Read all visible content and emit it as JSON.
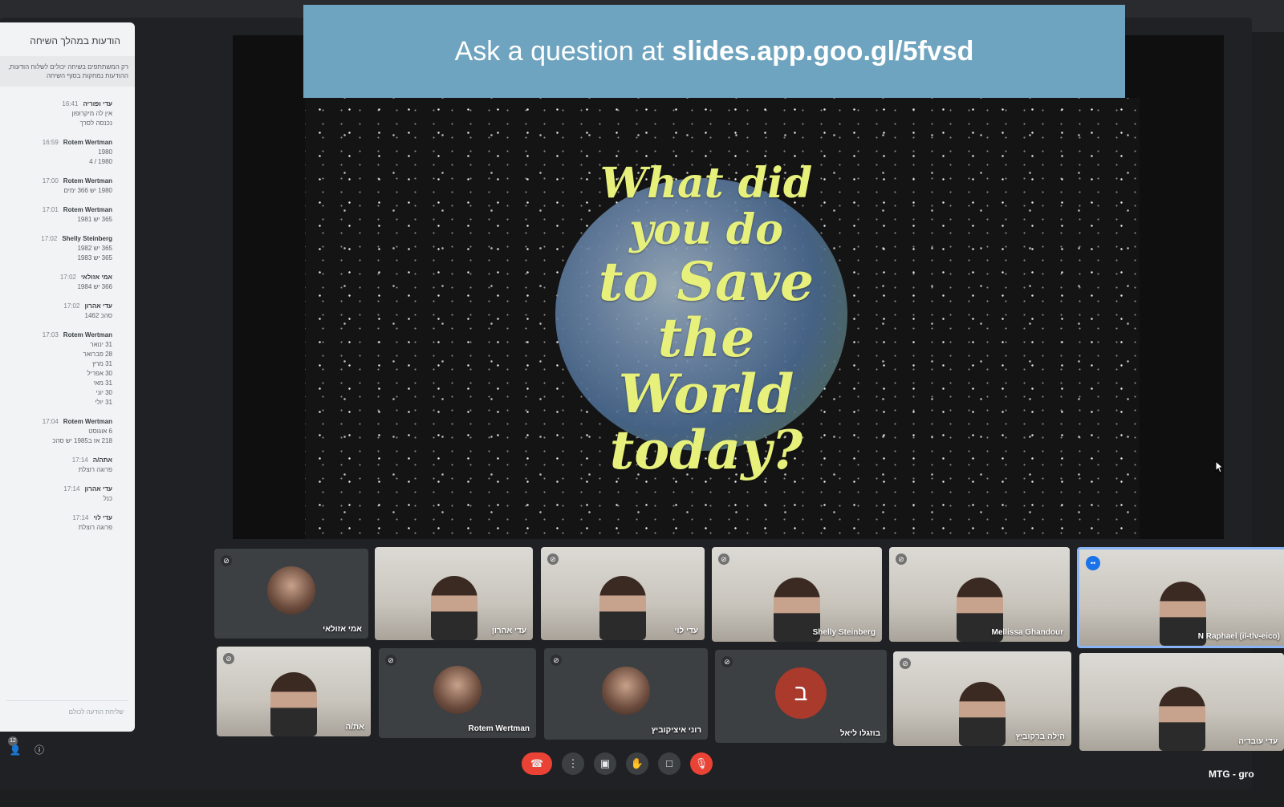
{
  "chat": {
    "title": "הודעות במהלך השיחה",
    "notice": "רק המשתתפים בשיחה יכולים לשלוח הודעות, ההודעות נמחקות בסוף השיחה",
    "messages": [
      {
        "sender": "עדי ופוריה",
        "time": "16:41",
        "lines": [
          "אין לה מיקרופון",
          "נכנסה לסרך"
        ]
      },
      {
        "sender": "Rotem Wertman",
        "time": "16:59",
        "lines": [
          "1980",
          "1980 / 4"
        ]
      },
      {
        "sender": "Rotem Wertman",
        "time": "17:00",
        "lines": [
          "1980 יש 366 ימים"
        ]
      },
      {
        "sender": "Rotem Wertman",
        "time": "17:01",
        "lines": [
          "365 יש 1981"
        ]
      },
      {
        "sender": "Shelly Steinberg",
        "time": "17:02",
        "lines": [
          "365 יש 1982",
          "365 יש 1983"
        ]
      },
      {
        "sender": "אמי אזולאי",
        "time": "17:02",
        "lines": [
          "366 יש 1984"
        ]
      },
      {
        "sender": "עדי אהרון",
        "time": "17:02",
        "lines": [
          "סהכ 1462"
        ]
      },
      {
        "sender": "Rotem Wertman",
        "time": "17:03",
        "lines": [
          "31 ינואר",
          "28 פברואר",
          "31 מרץ",
          "30 אפריל",
          "31 מאי",
          "30 יוני",
          "31 יולי"
        ]
      },
      {
        "sender": "Rotem Wertman",
        "time": "17:04",
        "lines": [
          "6 אוגוסט",
          "218 אז ב1985 יש סהכ"
        ]
      },
      {
        "sender": "אתה/ה",
        "time": "17:14",
        "lines": [
          "פרוגה רוצלת"
        ]
      },
      {
        "sender": "עדי אהרון",
        "time": "17:14",
        "lines": [
          "כנל"
        ]
      },
      {
        "sender": "עדי לוי",
        "time": "17:14",
        "lines": [
          "פרוגה רוצלת"
        ]
      }
    ],
    "input_placeholder": "שליחת הודעה לכולם"
  },
  "slide": {
    "banner_prefix": "Ask a question at",
    "banner_url": "slides.app.goo.gl/5fvsd",
    "headline_words": [
      "What did",
      "you do",
      "to Save",
      "the World",
      "today?"
    ]
  },
  "participants": [
    {
      "name": "אמי אזולאי",
      "type": "avatar",
      "muted": true
    },
    {
      "name": "עדי אהרון",
      "type": "video",
      "muted": false
    },
    {
      "name": "עדי לוי",
      "type": "video",
      "muted": true
    },
    {
      "name": "Shelly Steinberg",
      "type": "video",
      "muted": true
    },
    {
      "name": "Mellissa Ghandour",
      "type": "video",
      "muted": true
    },
    {
      "name": "N Raphael (il-tlv-eico)",
      "type": "video",
      "muted": false,
      "speaking": true
    },
    {
      "name": "את/ה",
      "type": "video",
      "muted": true
    },
    {
      "name": "Rotem Wertman",
      "type": "avatar",
      "muted": true
    },
    {
      "name": "רוני איציקוביץ",
      "type": "avatar",
      "muted": true
    },
    {
      "name": "בוזגלו ליאל",
      "type": "letter",
      "letter": "ב",
      "muted": true
    },
    {
      "name": "הילה ברקוביץ",
      "type": "video",
      "muted": true
    },
    {
      "name": "עדי עובדיה",
      "type": "video",
      "muted": false
    }
  ],
  "controls": {
    "icons": [
      "hang-up",
      "more-options",
      "present",
      "raise-hand",
      "camera",
      "mic-off"
    ]
  },
  "bottom_left": {
    "badge_count": "12"
  },
  "meeting_code": "MTG - gro",
  "colors": {
    "accent": "#8ab4f8",
    "hangup": "#ea4335",
    "banner": "#6ea4bf",
    "slide_text": "#e6f07a"
  }
}
